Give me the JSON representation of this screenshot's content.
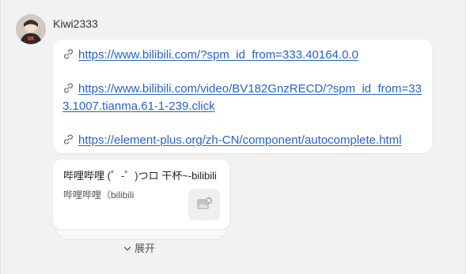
{
  "message": {
    "username": "Kiwi2333",
    "links": [
      {
        "icon": "link-icon",
        "url": "https://www.bilibili.com/?spm_id_from=333.40164.0.0"
      },
      {
        "icon": "link-icon",
        "url": "https://www.bilibili.com/video/BV182GnzRECD/?spm_id_from=333.1007.tianma.61-1-239.click"
      },
      {
        "icon": "link-icon",
        "url": "https://element-plus.org/zh-CN/component/autocomplete.html"
      }
    ]
  },
  "link_card": {
    "title": "哔哩哔哩 (゜-゜)つロ 干杯~-bilibili",
    "site": "哔哩哔哩（bilibili",
    "thumbnail_icon": "broken-image-icon"
  },
  "expand": {
    "label": "展开",
    "icon": "chevron-down-icon"
  },
  "colors": {
    "link": "#2563c9",
    "background": "#f2f2f2",
    "bubble": "#ffffff"
  }
}
